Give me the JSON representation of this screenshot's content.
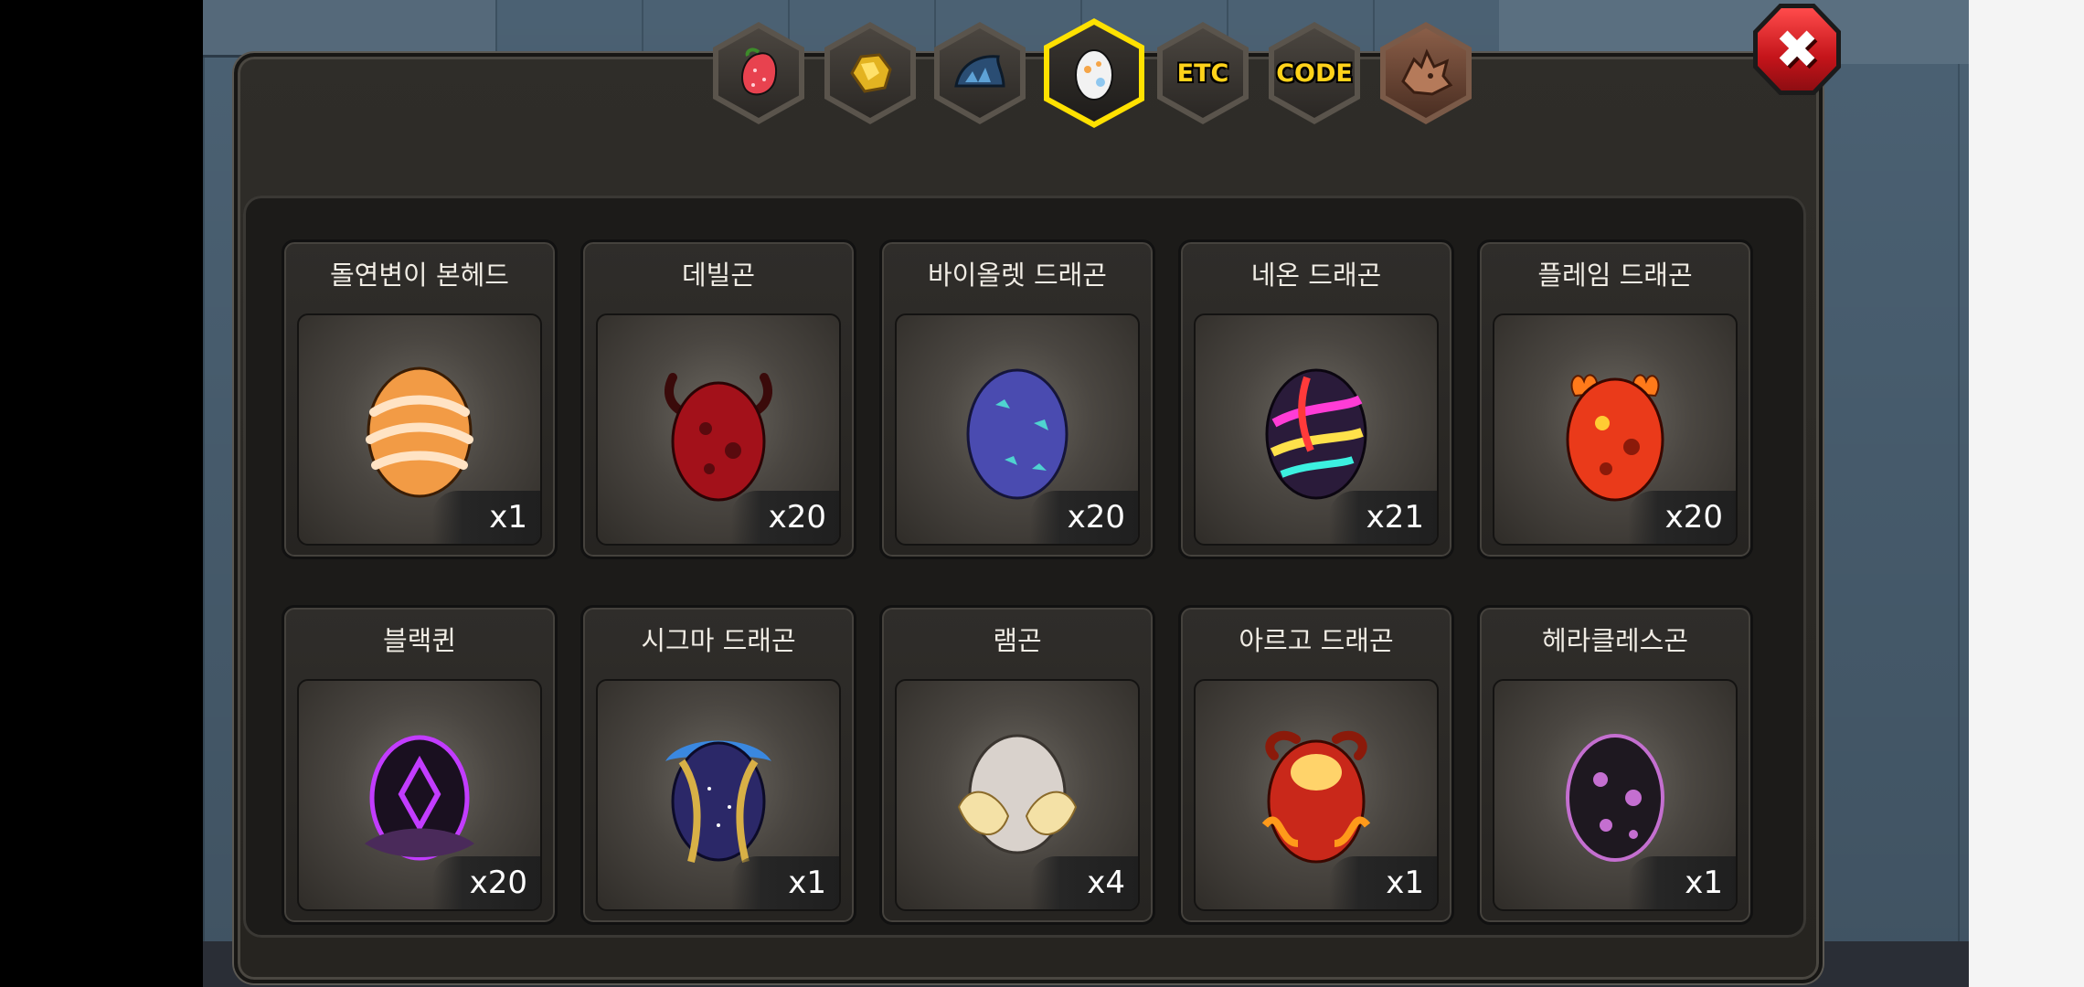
{
  "tabs": [
    {
      "id": "fruit",
      "icon": "fruit-icon"
    },
    {
      "id": "gold",
      "icon": "gold-icon"
    },
    {
      "id": "scale",
      "icon": "dragon-scale-icon"
    },
    {
      "id": "egg",
      "icon": "egg-icon",
      "active": true
    },
    {
      "id": "etc",
      "label": "ETC"
    },
    {
      "id": "code",
      "label": "CODE"
    },
    {
      "id": "dragon",
      "icon": "dragon-head-icon"
    }
  ],
  "close_label": "✖",
  "eggs": [
    {
      "name": "돌연변이 본헤드",
      "qty": "x1",
      "color": "#f7a24a",
      "accent": "#ffe1b5"
    },
    {
      "name": "데빌곤",
      "qty": "x20",
      "color": "#a3111a",
      "accent": "#5a0a0e"
    },
    {
      "name": "바이올렛 드래곤",
      "qty": "x20",
      "color": "#4a4bb0",
      "accent": "#4fd3d0"
    },
    {
      "name": "네온 드래곤",
      "qty": "x21",
      "color": "#2a1b3a",
      "accent": "#ff3cd6"
    },
    {
      "name": "플레임 드래곤",
      "qty": "x20",
      "color": "#ea3a1a",
      "accent": "#ffcc33"
    },
    {
      "name": "블랙퀸",
      "qty": "x20",
      "color": "#1a1020",
      "accent": "#c23cff"
    },
    {
      "name": "시그마 드래곤",
      "qty": "x1",
      "color": "#2b2868",
      "accent": "#d8b046"
    },
    {
      "name": "램곤",
      "qty": "x4",
      "color": "#d9d2cc",
      "accent": "#f4e1a6"
    },
    {
      "name": "아르고 드래곤",
      "qty": "x1",
      "color": "#c9281a",
      "accent": "#ff9a1a"
    },
    {
      "name": "헤라클레스곤",
      "qty": "x1",
      "color": "#1e1820",
      "accent": "#c46fd0"
    }
  ]
}
